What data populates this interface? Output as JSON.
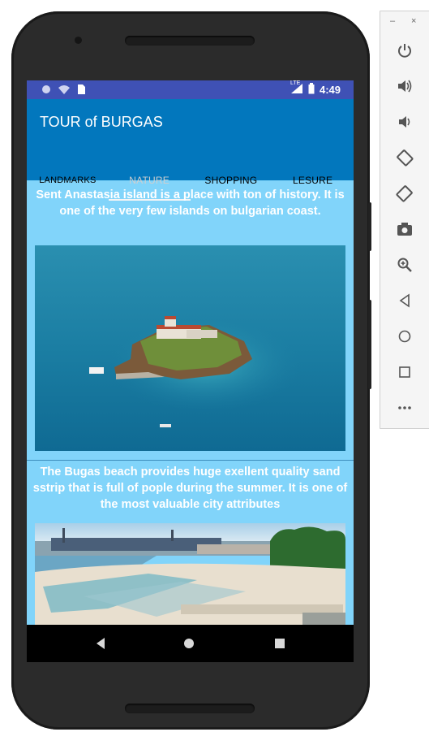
{
  "status_bar": {
    "time": "4:49",
    "network_label": "LTE"
  },
  "app": {
    "title": "TOUR of BURGAS"
  },
  "tabs": [
    {
      "label": "LANDMARKS",
      "active": false
    },
    {
      "label": "NATURE",
      "active": true
    },
    {
      "label": "SHOPPING",
      "active": false
    },
    {
      "label": "LESURE",
      "active": false
    }
  ],
  "cards": [
    {
      "text": "Sent Anastasia island is a place with ton of history. It is one of the very few islands on bulgarian coast.",
      "image": "island-photo"
    },
    {
      "text": "The Bugas beach provides huge exellent quality sand sstrip that is full of pople during the summer. It is one of the most valuable city attributes",
      "image": "beach-photo"
    }
  ],
  "emulator_panel": {
    "minimize_label": "–",
    "close_label": "×",
    "controls": [
      "power-icon",
      "volume-up-icon",
      "volume-down-icon",
      "rotate-left-icon",
      "rotate-right-icon",
      "camera-icon",
      "zoom-icon",
      "back-icon",
      "home-icon",
      "overview-icon",
      "more-icon"
    ]
  },
  "colors": {
    "status_bar": "#3f51b5",
    "app_bar": "#0277bd",
    "content_bg": "#81d4fa",
    "phone_body": "#2b2b2b"
  }
}
